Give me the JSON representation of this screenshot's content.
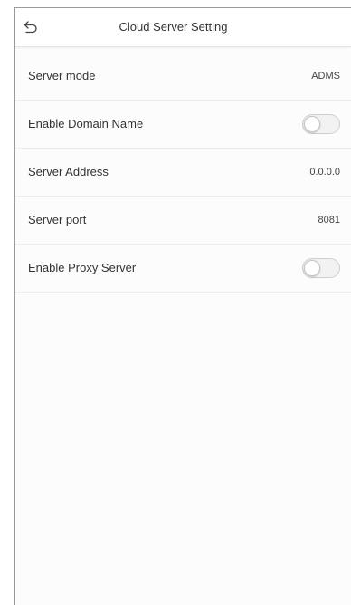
{
  "header": {
    "title": "Cloud Server Setting",
    "back_icon": "back-arrow-icon"
  },
  "settings": [
    {
      "label": "Server mode",
      "value": "ADMS",
      "type": "value"
    },
    {
      "label": "Enable Domain Name",
      "type": "toggle",
      "enabled": false
    },
    {
      "label": "Server Address",
      "value": "0.0.0.0",
      "type": "value"
    },
    {
      "label": "Server port",
      "value": "8081",
      "type": "value"
    },
    {
      "label": "Enable Proxy Server",
      "type": "toggle",
      "enabled": false
    }
  ],
  "colors": {
    "background": "#fcfcfc",
    "text": "#333333",
    "divider": "#ececec",
    "toggle_off": "#f2f2f2"
  }
}
